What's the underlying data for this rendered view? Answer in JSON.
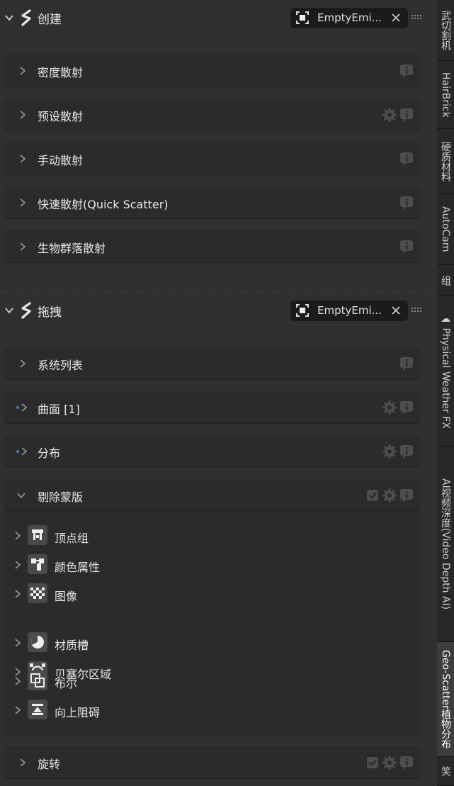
{
  "sections": [
    {
      "title": "创建",
      "emitter": "EmptyEmi...",
      "panels": [
        {
          "label": "密度散射",
          "icons": [
            "info"
          ]
        },
        {
          "label": "预设散射",
          "icons": [
            "gear",
            "info"
          ]
        },
        {
          "label": "手动散射",
          "icons": [
            "info"
          ]
        },
        {
          "label": "快速散射(Quick Scatter)",
          "icons": [
            "info"
          ]
        },
        {
          "label": "生物群落散射",
          "icons": [
            "info"
          ]
        }
      ]
    },
    {
      "title": "拖拽",
      "emitter": "EmptyEmi...",
      "panels": [
        {
          "label": "系统列表",
          "icons": [
            "info"
          ]
        },
        {
          "label": "曲面 [1]",
          "icons": [
            "gear",
            "info"
          ]
        },
        {
          "label": "分布",
          "icons": [
            "gear",
            "info"
          ]
        }
      ],
      "mask_panel": {
        "label": "剔除蒙版",
        "icons": [
          "check",
          "gear",
          "info"
        ],
        "items": [
          {
            "label": "顶点组",
            "icon": "vertex-group-icon"
          },
          {
            "label": "颜色属性",
            "icon": "color-attribute-icon"
          },
          {
            "label": "图像",
            "icon": "image-checker-icon"
          },
          {
            "label": "材质槽",
            "icon": "material-slot-icon"
          },
          {
            "label": "贝塞尔区域",
            "icon": "bezier-area-icon"
          },
          {
            "label": "布尔",
            "icon": "boolean-icon"
          },
          {
            "label": "向上阻碍",
            "icon": "upward-obstruction-icon"
          }
        ]
      },
      "rotate_panel": {
        "label": "旋转",
        "icons": [
          "check",
          "gear",
          "info"
        ]
      }
    }
  ],
  "side_tabs": [
    {
      "label": "武切割机"
    },
    {
      "label": "HairBrick"
    },
    {
      "label": "硬质材料"
    },
    {
      "label": "AutoCam"
    },
    {
      "label": "组"
    },
    {
      "label": "☁ Physical Weather FX"
    },
    {
      "label": "AI视频深度(Video Depth AI)"
    },
    {
      "label": "Geo-Scatter植物分布",
      "active": true
    },
    {
      "label": "笑"
    }
  ],
  "colors": {
    "background": "#303030",
    "panel": "#2b2b2b",
    "pill": "#1b1b1b",
    "dot_accent": "#4f79c7"
  }
}
